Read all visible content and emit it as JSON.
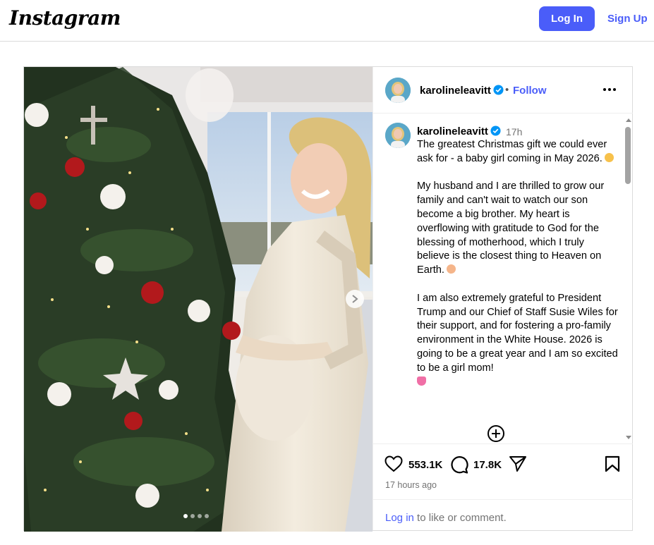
{
  "topbar": {
    "logo": "Instagram",
    "login_label": "Log In",
    "signup_label": "Sign Up"
  },
  "post": {
    "username": "karolineleavitt",
    "follow_label": "Follow",
    "separator": "•",
    "caption_time": "17h",
    "caption_paragraphs": [
      "The greatest Christmas gift we could ever ask for - a baby girl coming in May 2026.",
      "My husband and I are thrilled to grow our family and can't wait to watch our son become a big brother. My heart is overflowing with gratitude to God for the blessing of motherhood, which I truly believe is the closest thing to Heaven on Earth.",
      "I am also extremely grateful to President Trump and our Chief of Staff Susie Wiles for their support, and for fostering a pro-family environment in the White House. 2026 is going to be a great year and I am so excited to be a girl mom!"
    ],
    "likes": "553.1K",
    "comments": "17.8K",
    "posted_time": "17 hours ago",
    "login_link": "Log in",
    "login_suffix": " to like or comment.",
    "carousel_total": 4,
    "carousel_active": 1
  },
  "colors": {
    "accent": "#4a5df9",
    "muted": "#737373",
    "border": "#dbdbdb",
    "verified": "#0095f6"
  },
  "icons": [
    "heart-icon",
    "comment-icon",
    "share-icon",
    "bookmark-icon",
    "verified-icon",
    "more-icon",
    "chevron-right-icon",
    "add-circle-icon"
  ]
}
